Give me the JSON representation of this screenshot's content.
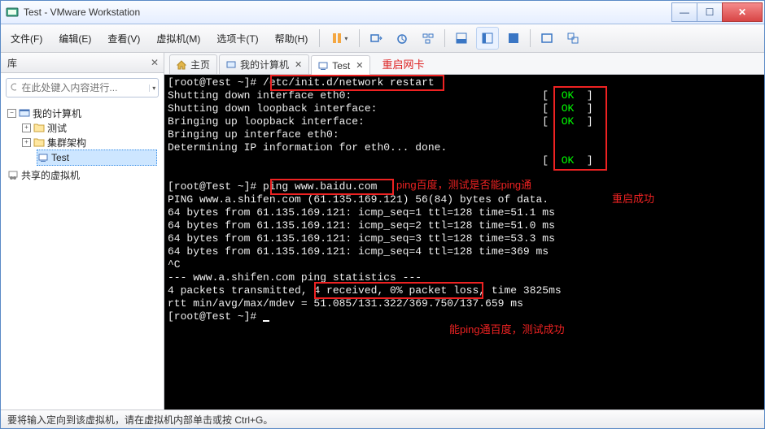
{
  "window": {
    "title": "Test - VMware Workstation"
  },
  "menus": {
    "file": "文件(F)",
    "edit": "编辑(E)",
    "view": "查看(V)",
    "vm": "虚拟机(M)",
    "tabs": "选项卡(T)",
    "help": "帮助(H)"
  },
  "sidebar": {
    "title": "库",
    "search_placeholder": "在此处键入内容进行...",
    "tree": {
      "root": "我的计算机",
      "items": [
        "测试",
        "集群架构",
        "Test"
      ],
      "shared": "共享的虚拟机"
    }
  },
  "tabs": {
    "home": "主页",
    "mypc": "我的计算机",
    "test": "Test"
  },
  "annotations": {
    "restart_nic": "重启网卡",
    "restart_success": "重启成功",
    "ping_baidu": "ping百度，测试是否能ping通",
    "ping_ok": "能ping通百度，测试成功"
  },
  "terminal": {
    "l1a": "[root@Test ~]# ",
    "l1b": "/etc/init.d/network restart",
    "l2": "Shutting down interface eth0:                              [  ",
    "l3": "Shutting down loopback interface:                          [  ",
    "l4": "Bringing up loopback interface:                            [  ",
    "l5": "Bringing up interface eth0:  ",
    "l6": "Determining IP information for eth0... done.",
    "l7": "                                                           [  ",
    "ok": "OK",
    "okc": "  ]",
    "l8": "",
    "l9a": "[root@Test ~]# ",
    "l9b": "ping www.baidu.com",
    "l10": "PING www.a.shifen.com (61.135.169.121) 56(84) bytes of data.",
    "l11": "64 bytes from 61.135.169.121: icmp_seq=1 ttl=128 time=51.1 ms",
    "l12": "64 bytes from 61.135.169.121: icmp_seq=2 ttl=128 time=51.0 ms",
    "l13": "64 bytes from 61.135.169.121: icmp_seq=3 ttl=128 time=53.3 ms",
    "l14": "64 bytes from 61.135.169.121: icmp_seq=4 ttl=128 time=369 ms",
    "l15": "^C",
    "l16": "--- www.a.shifen.com ping statistics ---",
    "l17a": "4 packets transmitted, ",
    "l17b": "4 received, 0% packet loss",
    "l17c": ", time 3825ms",
    "l18": "rtt min/avg/max/mdev = 51.085/131.322/369.750/137.659 ms",
    "l19": "[root@Test ~]# "
  },
  "status": "要将输入定向到该虚拟机，请在虚拟机内部单击或按 Ctrl+G。"
}
